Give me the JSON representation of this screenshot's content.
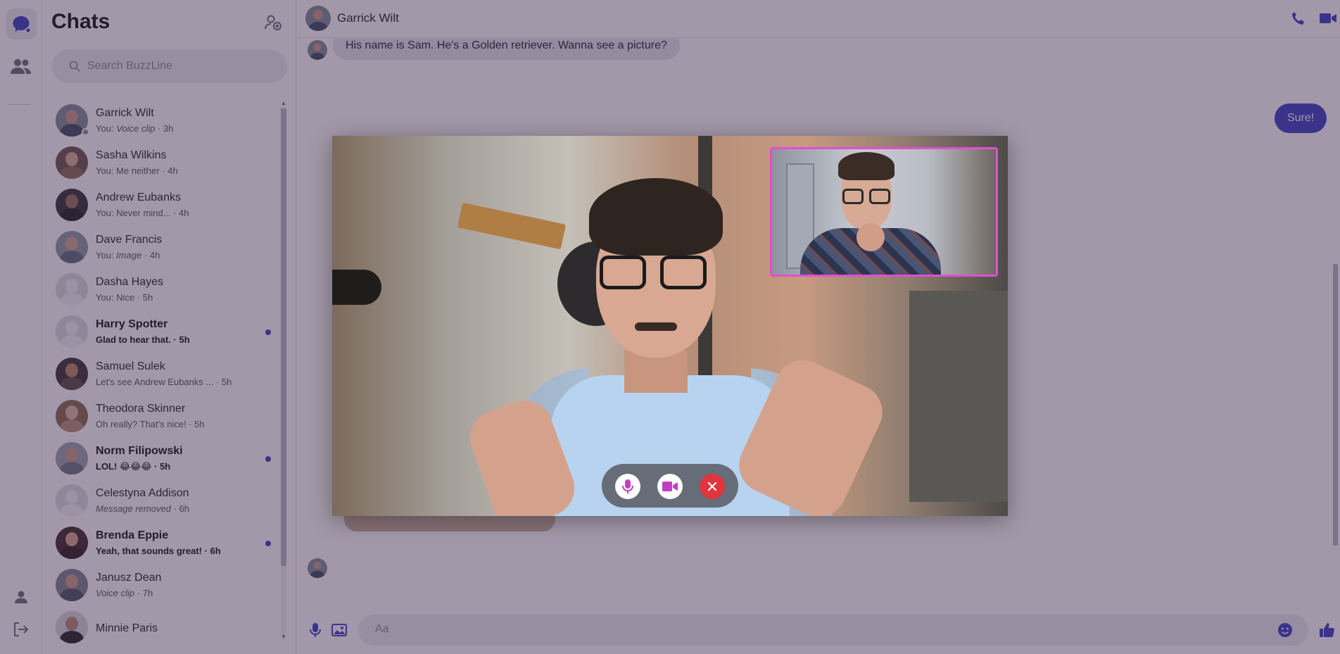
{
  "sidebar": {
    "title": "Chats",
    "search_placeholder": "Search BuzzLine",
    "chats": [
      {
        "name": "Garrick Wilt",
        "preview_prefix": "You: ",
        "preview_em": "Voice clip",
        "preview_text": "",
        "time": " · 3h",
        "unread": false
      },
      {
        "name": "Sasha Wilkins",
        "preview_prefix": "",
        "preview_em": "",
        "preview_text": "You: Me neither",
        "time": " · 4h",
        "unread": false
      },
      {
        "name": "Andrew Eubanks",
        "preview_prefix": "",
        "preview_em": "",
        "preview_text": "You: Never mind...",
        "time": " · 4h",
        "unread": false
      },
      {
        "name": "Dave Francis",
        "preview_prefix": "You: ",
        "preview_em": "Image",
        "preview_text": "",
        "time": " · 4h",
        "unread": false
      },
      {
        "name": "Dasha Hayes",
        "preview_prefix": "",
        "preview_em": "",
        "preview_text": "You: Nice",
        "time": " · 5h",
        "unread": false
      },
      {
        "name": "Harry Spotter",
        "preview_prefix": "",
        "preview_em": "",
        "preview_text": "Glad to hear that.",
        "time": " · 5h",
        "unread": true
      },
      {
        "name": "Samuel Sulek",
        "preview_prefix": "",
        "preview_em": "",
        "preview_text": "Let's see Andrew Eubanks ...",
        "time": " · 5h",
        "unread": false
      },
      {
        "name": "Theodora Skinner",
        "preview_prefix": "",
        "preview_em": "",
        "preview_text": "Oh really? That's nice!",
        "time": " · 5h",
        "unread": false
      },
      {
        "name": "Norm Filipowski",
        "preview_prefix": "",
        "preview_em": "",
        "preview_text": "LOL! 😂😂😂",
        "time": " · 5h",
        "unread": true
      },
      {
        "name": "Celestyna Addison",
        "preview_prefix": "",
        "preview_em": "Message removed",
        "preview_text": "",
        "time": " · 6h",
        "unread": false
      },
      {
        "name": "Brenda Eppie",
        "preview_prefix": "",
        "preview_em": "",
        "preview_text": "Yeah, that sounds great!",
        "time": " · 6h",
        "unread": true
      },
      {
        "name": "Janusz Dean",
        "preview_prefix": "",
        "preview_em": "Voice clip",
        "preview_text": "",
        "time": " · 7h",
        "unread": false
      },
      {
        "name": "Minnie Paris",
        "preview_prefix": "",
        "preview_em": "",
        "preview_text": "",
        "time": "",
        "unread": false
      }
    ]
  },
  "conversation": {
    "contact_name": "Garrick Wilt",
    "incoming_message": "His name is Sam. He's a Golden retriever. Wanna see a picture?",
    "outgoing_message": "Sure!",
    "composer_placeholder": "Aa"
  },
  "call": {
    "mic_icon": "microphone-icon",
    "camera_icon": "video-camera-icon",
    "end_icon": "close-icon"
  },
  "colors": {
    "accent": "#3b3fc4",
    "call_accent": "#c23fc1",
    "end_call": "#e0353d",
    "overlay": "#3c284b"
  }
}
